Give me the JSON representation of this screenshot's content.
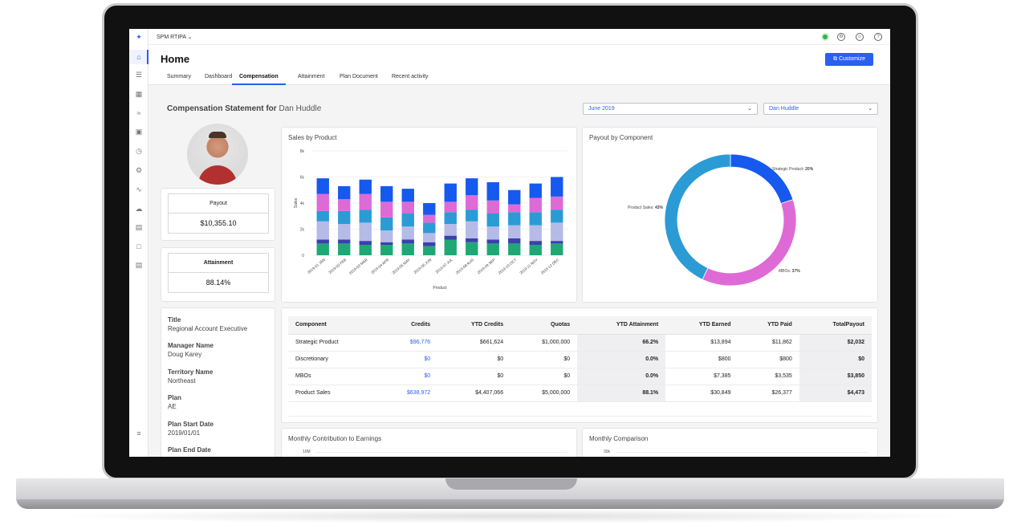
{
  "app": {
    "name": "SPM RTIPA"
  },
  "page": {
    "title": "Home",
    "customize_label": "Customize"
  },
  "tabs": [
    "Summary",
    "Dashboard",
    "Compensation",
    "Attainment",
    "Plan Document",
    "Recent activity"
  ],
  "active_tab": "Compensation",
  "statement": {
    "prefix": "Compensation Statement for",
    "name": "Dan Huddle"
  },
  "filters": {
    "period": "June 2019",
    "person": "Dan Huddle"
  },
  "payout": {
    "label": "Payout",
    "value": "$10,355.10"
  },
  "attainment": {
    "label": "Attainment",
    "value": "88.14%"
  },
  "details": [
    {
      "label": "Title",
      "value": "Regional Account Executive"
    },
    {
      "label": "Manager Name",
      "value": "Doug Karey"
    },
    {
      "label": "Territory Name",
      "value": "Northeast"
    },
    {
      "label": "Plan",
      "value": "AE"
    },
    {
      "label": "Plan Start Date",
      "value": "2019/01/01"
    },
    {
      "label": "Plan End Date",
      "value": ""
    }
  ],
  "colors": {
    "accent": "#2a5ff0",
    "status": "#35b34a"
  },
  "sales_chart": {
    "title": "Sales by Product",
    "xlabel": "Product",
    "ylabel": "Sales",
    "yticks": [
      "0",
      "2k",
      "4k",
      "6k",
      "8k"
    ],
    "ymax": 8000,
    "categories": [
      "2019-01 JAN",
      "2019-02 FEB",
      "2019-03 MAR",
      "2019-04 APR",
      "2019-05 MAY",
      "2019-06 JUN",
      "2019-07 JUL",
      "2019-08 AUG",
      "2019-09 SEP",
      "2019-10 OCT",
      "2019-11 NOV",
      "2019-12 DEC"
    ],
    "series_colors": [
      "#1fa876",
      "#3c3fae",
      "#b5bbe6",
      "#2b9bd6",
      "#de6ad6",
      "#1559ef"
    ],
    "stacks": [
      [
        900,
        300,
        1400,
        800,
        1300,
        1200
      ],
      [
        900,
        300,
        1200,
        1000,
        900,
        1000
      ],
      [
        800,
        300,
        1400,
        1000,
        1200,
        1100
      ],
      [
        800,
        200,
        900,
        1000,
        1200,
        1200
      ],
      [
        900,
        300,
        1000,
        1000,
        900,
        1000
      ],
      [
        700,
        300,
        700,
        800,
        600,
        900
      ],
      [
        1200,
        300,
        900,
        900,
        800,
        1400
      ],
      [
        1000,
        300,
        1300,
        900,
        1100,
        1300
      ],
      [
        900,
        300,
        1000,
        1000,
        1000,
        1400
      ],
      [
        900,
        400,
        1000,
        1000,
        600,
        1100
      ],
      [
        800,
        300,
        1200,
        1000,
        1100,
        1100
      ],
      [
        900,
        200,
        1400,
        1000,
        1000,
        1500
      ]
    ]
  },
  "payout_chart": {
    "title": "Payout by Component",
    "slices": [
      {
        "label": "Strategic Product:",
        "pct": 20,
        "color": "#1559ef"
      },
      {
        "label": "MBOs:",
        "pct": 37,
        "color": "#de6ad6"
      },
      {
        "label": "Product Sales:",
        "pct": 43,
        "color": "#2b9bd6"
      }
    ]
  },
  "table": {
    "headers": [
      "Component",
      "Credits",
      "YTD Credits",
      "Quotas",
      "YTD Attainment",
      "YTD Earned",
      "YTD Paid",
      "TotalPayout"
    ],
    "rows": [
      [
        "Strategic Product",
        "$96,776",
        "$661,624",
        "$1,000,000",
        "66.2%",
        "$13,894",
        "$11,862",
        "$2,032"
      ],
      [
        "Discretionary",
        "$0",
        "$0",
        "$0",
        "0.0%",
        "$800",
        "$800",
        "$0"
      ],
      [
        "MBOs",
        "$0",
        "$0",
        "$0",
        "0.0%",
        "$7,385",
        "$3,535",
        "$3,850"
      ],
      [
        "Product Sales",
        "$638,972",
        "$4,407,066",
        "$5,000,000",
        "88.1%",
        "$30,849",
        "$26,377",
        "$4,473"
      ]
    ]
  },
  "bottom_charts": [
    {
      "title": "Monthly Contribution to Earnings",
      "first_tick": "10M"
    },
    {
      "title": "Monthly Comparison",
      "first_tick": "30k"
    }
  ]
}
